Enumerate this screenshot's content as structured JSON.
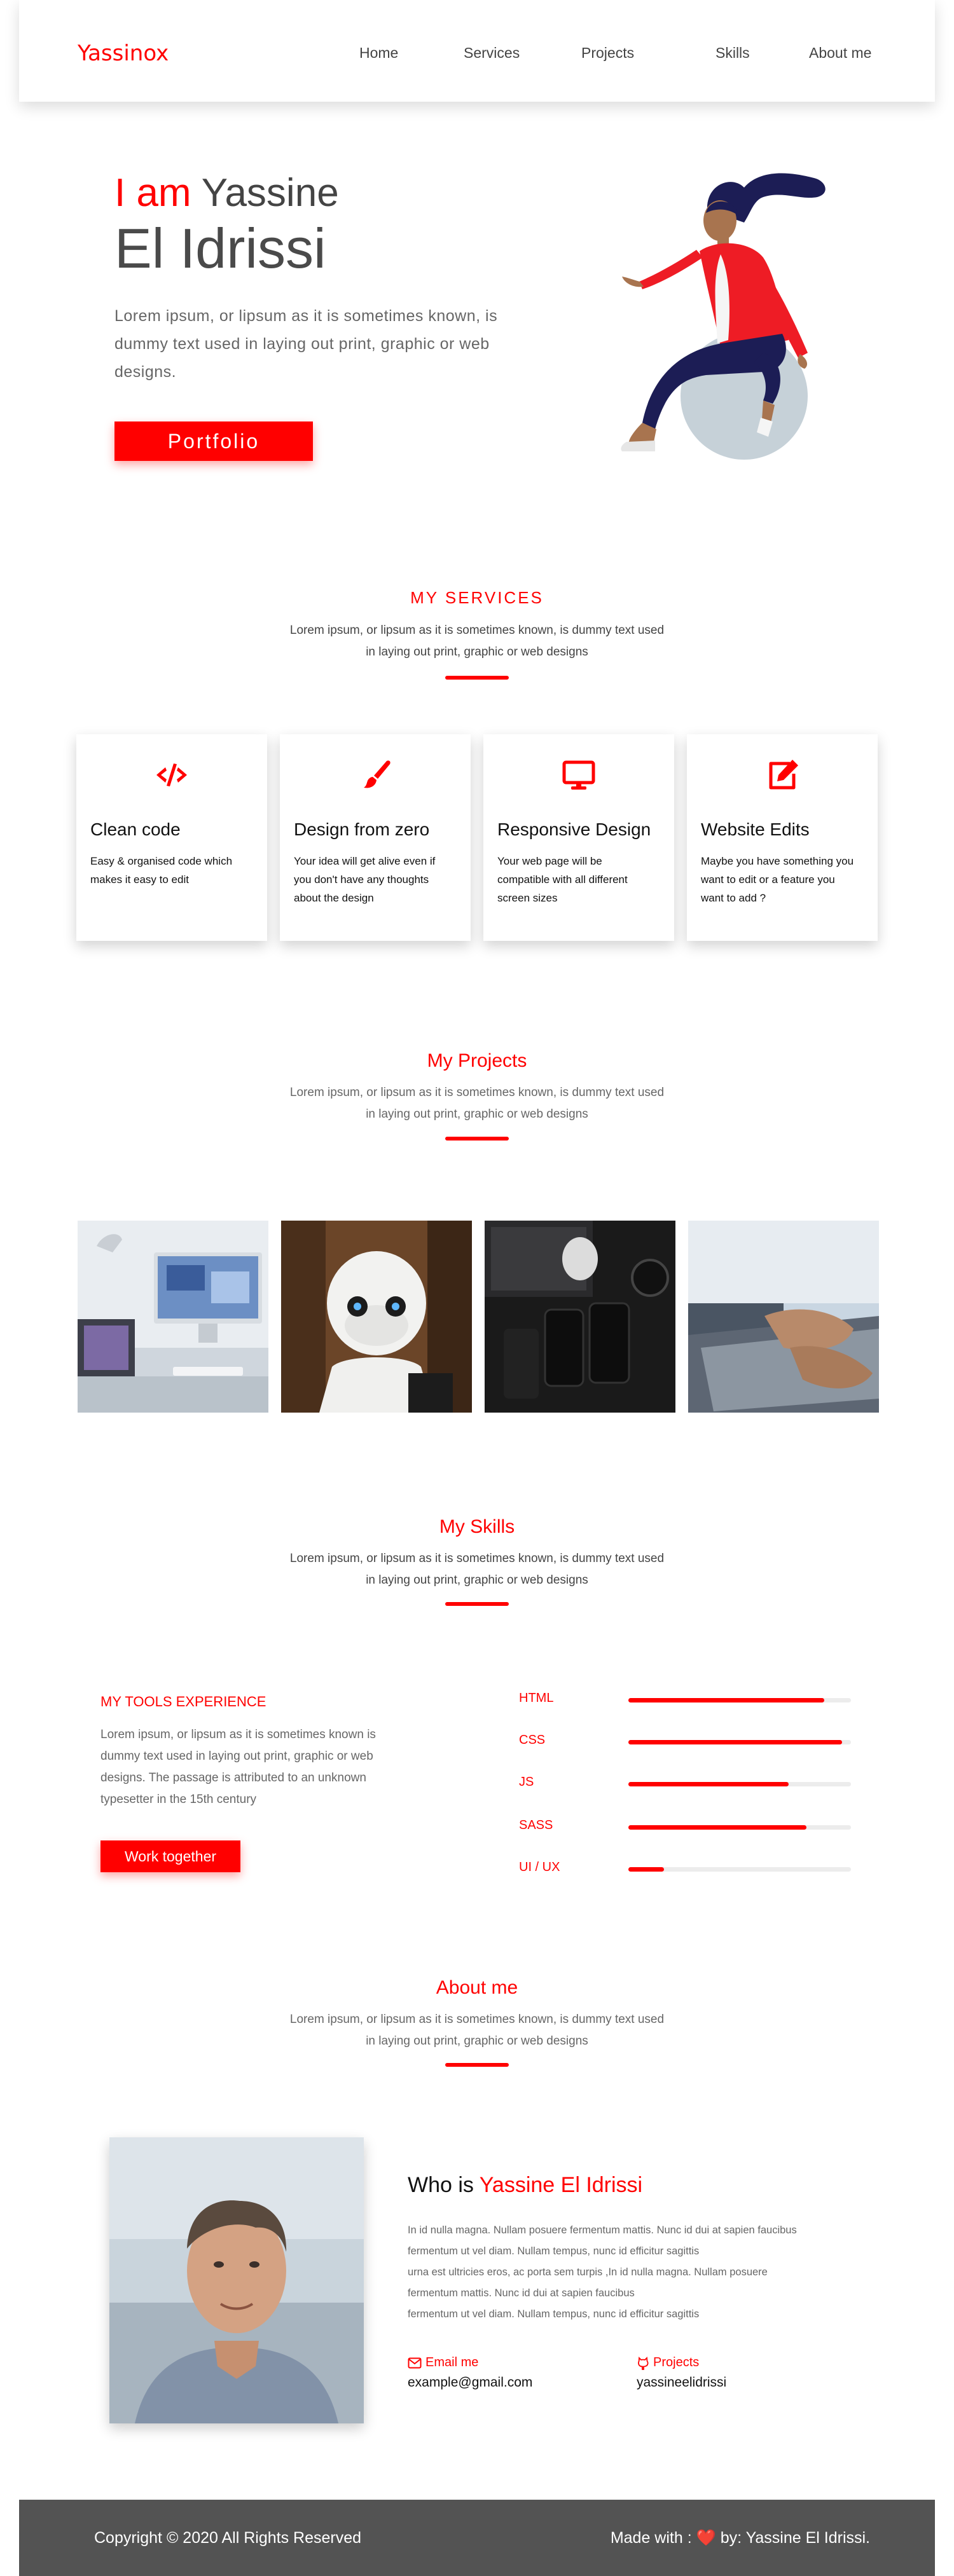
{
  "colors": {
    "accent": "#ff0000",
    "footer_bg": "#535353",
    "text_dark": "#444444",
    "text_muted": "#666666"
  },
  "nav": {
    "brand": "Yassinox",
    "links": [
      "Home",
      "Services",
      "Projects",
      "Skills",
      "About me"
    ]
  },
  "hero": {
    "intro_accent": "I am",
    "first_name": "Yassine",
    "last_name": "El Idrissi",
    "text": "Lorem ipsum, or lipsum as it is sometimes known, is dummy text used in laying out print, graphic or web designs.",
    "button": "Portfolio"
  },
  "services": {
    "title": "MY SERVICES",
    "subtitle": "Lorem ipsum, or lipsum as it is sometimes  known, is dummy text used in laying out print, graphic or web designs",
    "cards": [
      {
        "icon": "code-icon",
        "title": "Clean code",
        "desc": "Easy & organised code which makes it easy to edit"
      },
      {
        "icon": "paint-brush-icon",
        "title": "Design from zero",
        "desc": "Your idea will get alive even if you don't have any thoughts about the design"
      },
      {
        "icon": "desktop-icon",
        "title": "Responsive Design",
        "desc": "Your web page will be compatible with all different screen sizes"
      },
      {
        "icon": "edit-icon",
        "title": "Website Edits",
        "desc": "Maybe you have something you want to edit or a feature you want to add ?"
      }
    ]
  },
  "projects": {
    "title": "My  Projects",
    "subtitle": "Lorem ipsum, or lipsum as it is sometimes  known, is dummy text used in laying out print, graphic or web designs",
    "images": [
      "desk-computer-image",
      "robot-image",
      "laptop-phones-image",
      "typing-laptop-image"
    ]
  },
  "skills": {
    "title": "My Skills",
    "subtitle": "Lorem ipsum, or lipsum as it is sometimes  known, is dummy text used in laying out print, graphic or web designs",
    "tools_title": "MY TOOLS EXPERIENCE",
    "tools_text": "Lorem ipsum, or lipsum as it is sometimes known is dummy text used in laying out print, graphic or web designs. The passage is attributed to an unknown typesetter in the 15th century",
    "button": "Work together",
    "items": [
      {
        "name": "HTML",
        "level": 0.88
      },
      {
        "name": "CSS",
        "level": 0.96
      },
      {
        "name": "JS",
        "level": 0.72
      },
      {
        "name": "SASS",
        "level": 0.8
      },
      {
        "name": "UI / UX",
        "level": 0.16
      }
    ]
  },
  "about": {
    "title": "About me",
    "subtitle": "Lorem ipsum, or lipsum as it is sometimes  known, is dummy text used in laying out print, graphic or web designs",
    "who_prefix": "Who is",
    "who_name": "Yassine El Idrissi",
    "lines": [
      "In id nulla magna. Nullam posuere fermentum mattis. Nunc id dui at sapien faucibus",
      "fermentum ut vel diam. Nullam tempus, nunc id efficitur sagittis",
      "urna est ultricies eros, ac porta sem turpis ,In id nulla magna. Nullam posuere",
      "fermentum mattis. Nunc id dui at sapien faucibus",
      "fermentum ut vel diam. Nullam tempus, nunc id efficitur sagittis"
    ],
    "email_label": "Email me",
    "email_value": "example@gmail.com",
    "projects_label": "Projects",
    "projects_value": "yassineelidrissi"
  },
  "footer": {
    "copyright": "Copyright © 2020 All Rights Reserved",
    "made_prefix": "Made with :",
    "heart": "❤️",
    "made_suffix": "by: Yassine El Idrissi."
  }
}
